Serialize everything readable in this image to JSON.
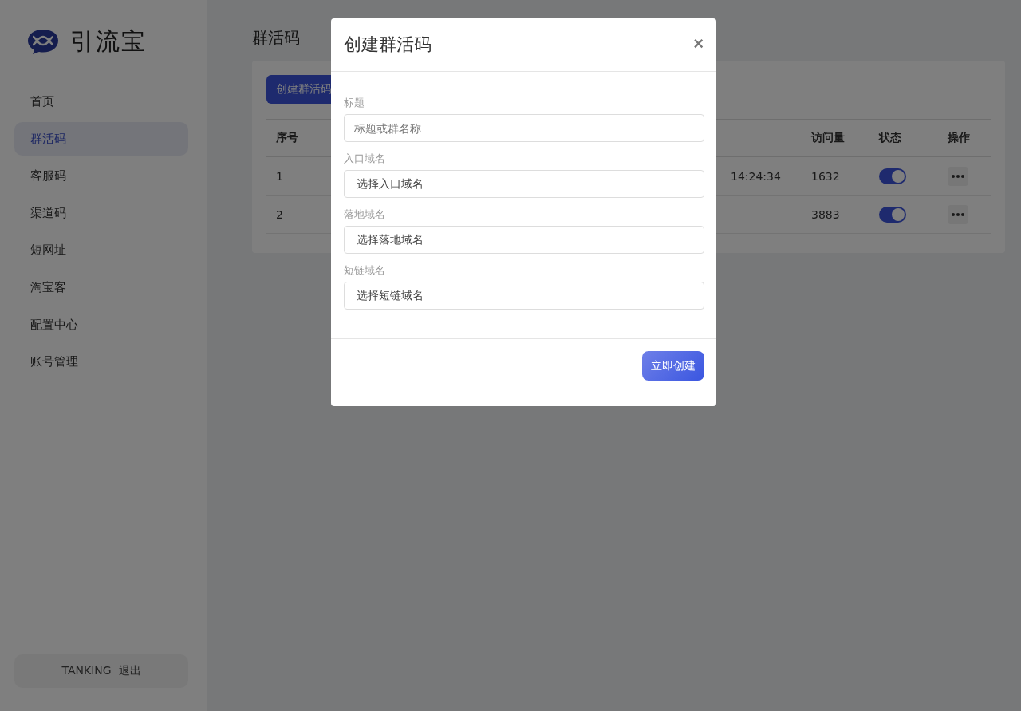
{
  "sidebar": {
    "brand": "引流宝",
    "items": [
      {
        "label": "首页",
        "selected": false
      },
      {
        "label": "群活码",
        "selected": true
      },
      {
        "label": "客服码",
        "selected": false
      },
      {
        "label": "渠道码",
        "selected": false
      },
      {
        "label": "短网址",
        "selected": false
      },
      {
        "label": "淘宝客",
        "selected": false
      },
      {
        "label": "配置中心",
        "selected": false
      },
      {
        "label": "账号管理",
        "selected": false
      }
    ],
    "account": {
      "user": "TANKING",
      "logout": "退出"
    }
  },
  "page": {
    "title": "群活码",
    "create_button": "创建群活码",
    "table": {
      "columns": [
        {
          "kind": "index",
          "label": "序号"
        },
        {
          "kind": "visits",
          "label": "访问量"
        },
        {
          "kind": "status",
          "label": "状态"
        },
        {
          "kind": "actions",
          "label": "操作"
        }
      ],
      "rows": [
        {
          "index": "1",
          "time": "14:24:34",
          "visits": "1632",
          "enabled": true
        },
        {
          "index": "2",
          "visits": "3883",
          "enabled": true
        }
      ]
    }
  },
  "dialog": {
    "title": "创建群活码",
    "close": "×",
    "fields": [
      {
        "label": "标题",
        "placeholder": "标题或群名称",
        "kind": "input"
      },
      {
        "label": "入口域名",
        "value": "选择入口域名",
        "kind": "select"
      },
      {
        "label": "落地域名",
        "value": "选择落地域名",
        "kind": "select"
      },
      {
        "label": "短链域名",
        "value": "选择短链域名",
        "kind": "select"
      }
    ],
    "submit": "立即创建"
  }
}
